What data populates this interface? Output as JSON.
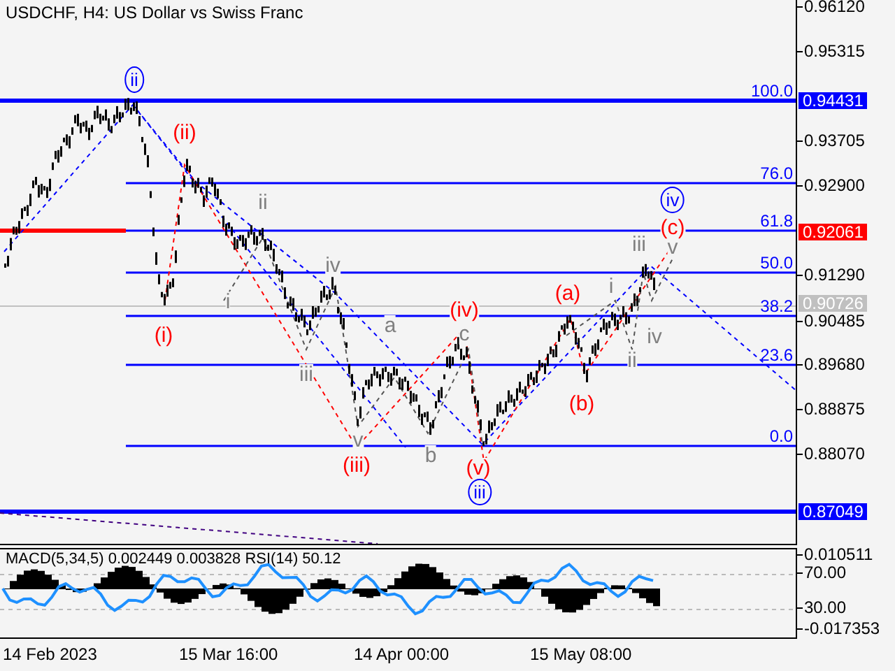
{
  "chart": {
    "title": "USDCHF, H4:  US Dollar vs Swiss Franc",
    "fib_levels": [
      {
        "label": "100.0"
      },
      {
        "label": "76.0"
      },
      {
        "label": "61.8"
      },
      {
        "label": "50.0"
      },
      {
        "label": "38.2"
      },
      {
        "label": "23.6"
      },
      {
        "label": "0.0"
      }
    ],
    "wave_labels": [
      {
        "text": "ii",
        "kind": "circled",
        "color": "#0000ff"
      },
      {
        "text": "(ii)",
        "kind": "plain",
        "color": "#ff0000"
      },
      {
        "text": "ii",
        "kind": "plain",
        "color": "#808080"
      },
      {
        "text": "iv",
        "kind": "plain",
        "color": "#808080"
      },
      {
        "text": "i",
        "kind": "plain",
        "color": "#808080"
      },
      {
        "text": "(i)",
        "kind": "plain",
        "color": "#ff0000"
      },
      {
        "text": "iii",
        "kind": "plain",
        "color": "#808080"
      },
      {
        "text": "a",
        "kind": "plain",
        "color": "#808080"
      },
      {
        "text": "(iv)",
        "kind": "plain",
        "color": "#ff0000"
      },
      {
        "text": "c",
        "kind": "plain",
        "color": "#808080"
      },
      {
        "text": "v",
        "kind": "plain",
        "color": "#808080"
      },
      {
        "text": "(iii)",
        "kind": "plain",
        "color": "#ff0000"
      },
      {
        "text": "b",
        "kind": "plain",
        "color": "#808080"
      },
      {
        "text": "(v)",
        "kind": "plain",
        "color": "#ff0000"
      },
      {
        "text": "iii",
        "kind": "circled",
        "color": "#0000ff"
      },
      {
        "text": "(a)",
        "kind": "plain",
        "color": "#ff0000"
      },
      {
        "text": "i",
        "kind": "plain",
        "color": "#808080"
      },
      {
        "text": "iv",
        "kind": "circled",
        "color": "#0000ff"
      },
      {
        "text": "(c)",
        "kind": "plain",
        "color": "#ff0000"
      },
      {
        "text": "iii",
        "kind": "plain",
        "color": "#808080"
      },
      {
        "text": "v",
        "kind": "plain",
        "color": "#808080"
      },
      {
        "text": "(b)",
        "kind": "plain",
        "color": "#ff0000"
      },
      {
        "text": "ii",
        "kind": "plain",
        "color": "#808080"
      },
      {
        "text": "iv",
        "kind": "plain",
        "color": "#808080"
      }
    ]
  },
  "price_axis": [
    {
      "label": "0.96120",
      "kind": "tick"
    },
    {
      "label": "0.95315",
      "kind": "tick"
    },
    {
      "label": "0.94431",
      "kind": "marker",
      "color": "#0000ff"
    },
    {
      "label": "0.93705",
      "kind": "tick"
    },
    {
      "label": "0.92900",
      "kind": "tick"
    },
    {
      "label": "0.92061",
      "kind": "marker",
      "color": "#ff0000"
    },
    {
      "label": "0.91290",
      "kind": "tick"
    },
    {
      "label": "0.90726",
      "kind": "marker",
      "color": "#c0c0c0"
    },
    {
      "label": "0.90485",
      "kind": "tick"
    },
    {
      "label": "0.89680",
      "kind": "tick"
    },
    {
      "label": "0.88875",
      "kind": "tick"
    },
    {
      "label": "0.88070",
      "kind": "tick"
    },
    {
      "label": "0.87049",
      "kind": "marker",
      "color": "#0000ff"
    }
  ],
  "indicator": {
    "label": "MACD(5,34,5) 0.002449 0.003828 RSI(14) 50.12",
    "axis": [
      {
        "label": "0.010511"
      },
      {
        "label": "70.00"
      },
      {
        "label": "30.00"
      },
      {
        "label": "-0.017353"
      }
    ]
  },
  "time_axis": [
    {
      "label": "14 Feb 2023"
    },
    {
      "label": "15 Mar 16:00"
    },
    {
      "label": "14 Apr 00:00"
    },
    {
      "label": "15 May 08:00"
    }
  ]
}
